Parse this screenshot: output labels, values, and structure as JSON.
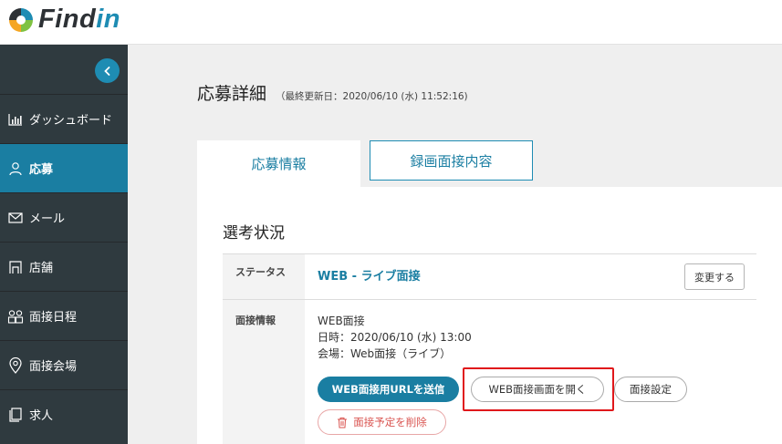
{
  "brand": {
    "name_part1": "Find",
    "name_part2": "in",
    "accent_color": "#1e8cb3"
  },
  "sidebar": {
    "collapse_icon": "chevron-left-icon",
    "items": [
      {
        "label": "ダッシュボード",
        "icon": "bar-chart-icon",
        "active": false
      },
      {
        "label": "応募",
        "icon": "user-icon",
        "active": true
      },
      {
        "label": "メール",
        "icon": "mail-icon",
        "active": false
      },
      {
        "label": "店舗",
        "icon": "store-icon",
        "active": false
      },
      {
        "label": "面接日程",
        "icon": "users-icon",
        "active": false
      },
      {
        "label": "面接会場",
        "icon": "map-pin-icon",
        "active": false
      },
      {
        "label": "求人",
        "icon": "document-icon",
        "active": false
      }
    ]
  },
  "page": {
    "title": "応募詳細",
    "last_updated": "（最終更新日：2020/06/10 (水) 11:52:16)"
  },
  "tabs": [
    {
      "label": "応募情報",
      "active": true
    },
    {
      "label": "録画面接内容",
      "active": false
    }
  ],
  "selection": {
    "section_title": "選考状況",
    "status_label": "ステータス",
    "status_value": "WEB - ライブ面接",
    "change_button": "変更する",
    "interview_label": "面接情報",
    "interview_type": "WEB面接",
    "interview_datetime": "日時：2020/06/10 (水) 13:00",
    "interview_venue": "会場：Web面接（ライブ）",
    "send_url_button": "WEB面接用URLを送信",
    "open_screen_button": "WEB面接画面を開く",
    "settings_button": "面接設定",
    "delete_button": "面接予定を削除"
  }
}
